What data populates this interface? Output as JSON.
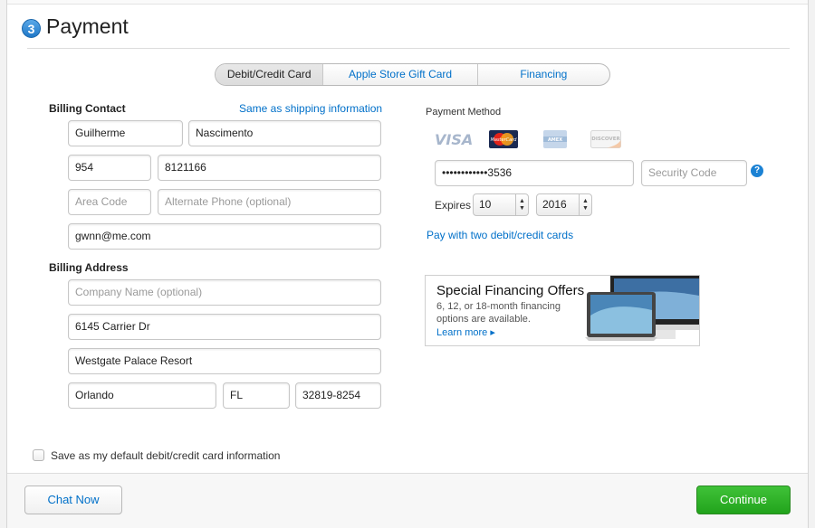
{
  "header": {
    "step_number": "3",
    "title": "Payment"
  },
  "tabs": [
    {
      "label": "Debit/Credit Card",
      "selected": true
    },
    {
      "label": "Apple Store Gift Card",
      "selected": false
    },
    {
      "label": "Financing",
      "selected": false
    }
  ],
  "billing_contact": {
    "heading": "Billing Contact",
    "same_as_shipping_link": "Same as shipping information",
    "first_name": "Guilherme",
    "last_name": "Nascimento",
    "area_code": "954",
    "phone": "8121166",
    "alt_area_code_placeholder": "Area Code",
    "alt_phone_placeholder": "Alternate Phone (optional)",
    "email": "gwnn@me.com"
  },
  "billing_address": {
    "heading": "Billing Address",
    "company_placeholder": "Company Name (optional)",
    "street": "6145 Carrier Dr",
    "street2": "Westgate Palace Resort",
    "city": "Orlando",
    "state": "FL",
    "zip": "32819-8254"
  },
  "payment_method": {
    "heading": "Payment Method",
    "card_logos": [
      "VISA",
      "MasterCard",
      "AMEX",
      "DISCOVER"
    ],
    "card_number": "••••••••••••3536",
    "security_code_placeholder": "Security Code",
    "expires_label": "Expires",
    "exp_month": "10",
    "exp_year": "2016",
    "two_cards_link": "Pay with two debit/credit cards"
  },
  "promo": {
    "title": "Special Financing Offers",
    "text": "6, 12, or 18-month financing options are available.",
    "link": "Learn more"
  },
  "save_default_label": "Save as my default debit/credit card information",
  "footer": {
    "chat_label": "Chat Now",
    "continue_label": "Continue"
  },
  "colors": {
    "accent": "#0070c9",
    "continue": "#22a31c"
  }
}
